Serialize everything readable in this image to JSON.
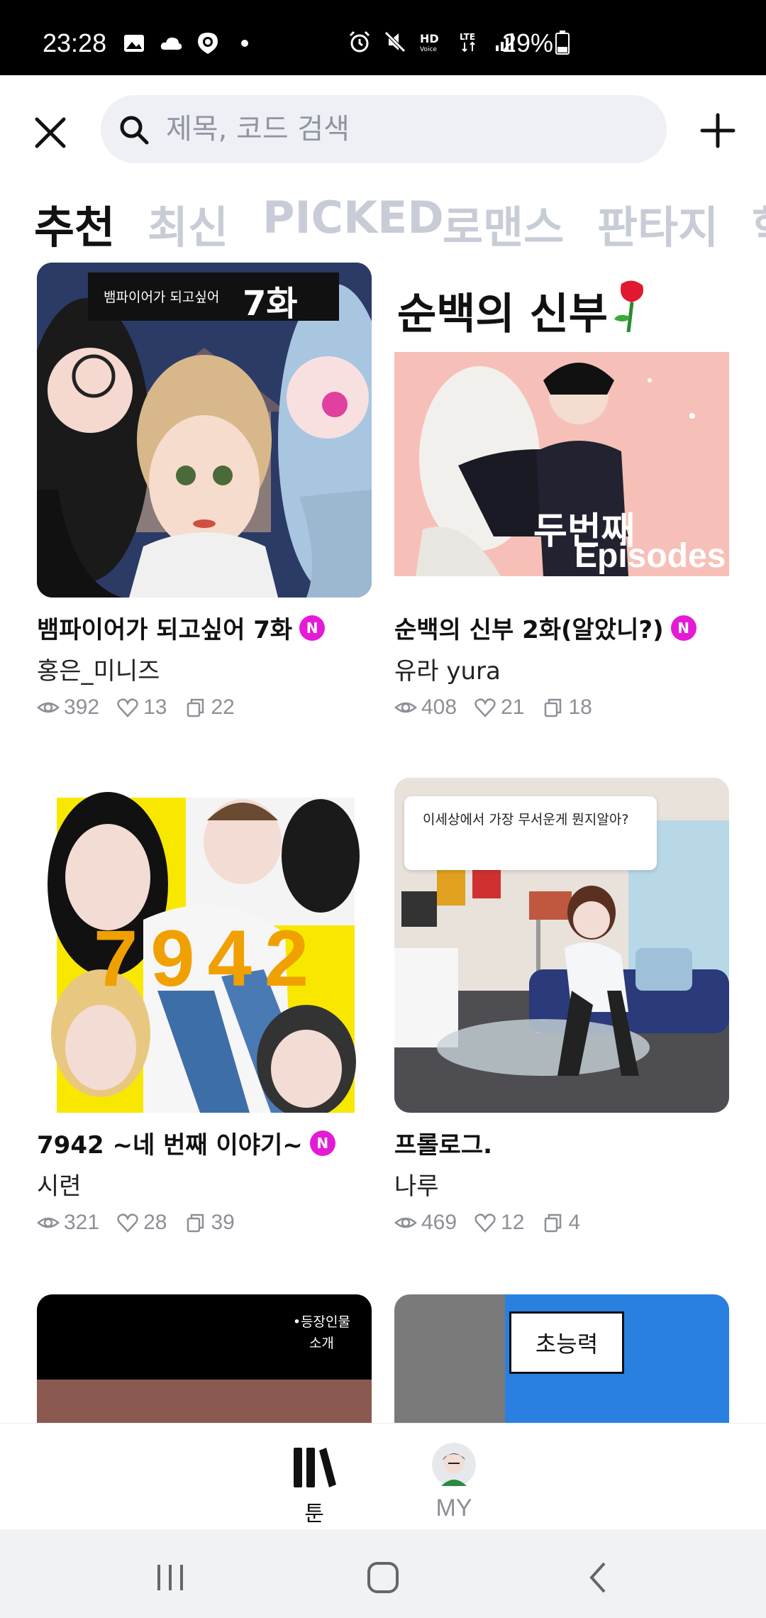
{
  "status_bar": {
    "time": "23:28",
    "battery_percent": "29%",
    "icons": [
      "gallery-icon",
      "cloud-icon",
      "zepeto-icon",
      "dot-icon",
      "alarm-icon",
      "mute-icon",
      "hd-voice-icon",
      "lte-icon",
      "signal-icon",
      "battery-icon"
    ]
  },
  "search": {
    "placeholder": "제목, 코드 검색"
  },
  "tabs": [
    {
      "label": "추천",
      "active": true
    },
    {
      "label": "최신",
      "active": false
    },
    {
      "label": "PICKED",
      "active": false
    },
    {
      "label": "로맨스",
      "active": false
    },
    {
      "label": "판타지",
      "active": false
    },
    {
      "label": "학",
      "active": false
    }
  ],
  "cards": [
    {
      "title": "뱀파이어가 되고싶어 7화",
      "badge": "N",
      "author": "홍은_미니즈",
      "views": "392",
      "likes": "13",
      "comments": "22",
      "thumb_text": "뱀파이어가 되고싶어",
      "thumb_text_big": "7화"
    },
    {
      "title": "순백의 신부 2화(알았니?)",
      "badge": "N",
      "author": "유라 yura",
      "views": "408",
      "likes": "21",
      "comments": "18",
      "thumb_title": "순백의 신부",
      "thumb_sub1": "두번째",
      "thumb_sub2": "Episodes"
    },
    {
      "title": "7942 ~네 번째 이야기~",
      "badge": "N",
      "author": "시련",
      "views": "321",
      "likes": "28",
      "comments": "39",
      "thumb_text": "7942"
    },
    {
      "title": "프롤로그.",
      "badge": "",
      "author": "나루",
      "views": "469",
      "likes": "12",
      "comments": "4",
      "thumb_bubble": "이세상에서 가장 무서운게 뭔지알아?"
    }
  ],
  "partial_cards": [
    {
      "thumb_text": "•등장인물\n소개"
    },
    {
      "thumb_text": "초능력"
    }
  ],
  "bottom_nav": {
    "toon_label": "툰",
    "my_label": "MY"
  },
  "colors": {
    "accent_badge": "#e41bd6",
    "tab_inactive": "#c7ccd6",
    "search_bg": "#eef0f5"
  }
}
